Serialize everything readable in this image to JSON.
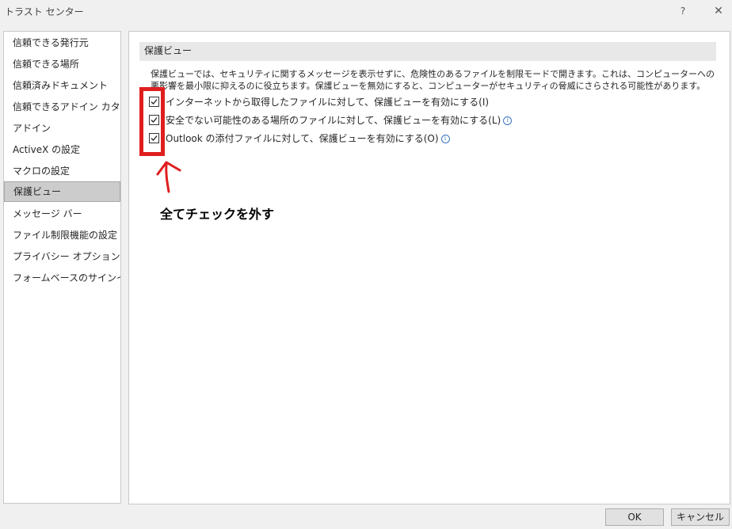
{
  "window": {
    "title": "トラスト センター",
    "help_label": "?",
    "close_label": "✕"
  },
  "sidebar": {
    "items": [
      {
        "label": "信頼できる発行元"
      },
      {
        "label": "信頼できる場所"
      },
      {
        "label": "信頼済みドキュメント"
      },
      {
        "label": "信頼できるアドイン カタログ"
      },
      {
        "label": "アドイン"
      },
      {
        "label": "ActiveX の設定"
      },
      {
        "label": "マクロの設定"
      },
      {
        "label": "保護ビュー",
        "selected": true
      },
      {
        "label": "メッセージ バー"
      },
      {
        "label": "ファイル制限機能の設定"
      },
      {
        "label": "プライバシー オプション"
      },
      {
        "label": "フォームベースのサインイン"
      }
    ]
  },
  "main": {
    "section_title": "保護ビュー",
    "description": "保護ビューでは、セキュリティに関するメッセージを表示せずに、危険性のあるファイルを制限モードで開きます。これは、コンピューターへの悪影響を最小限に抑えるのに役立ちます。保護ビューを無効にすると、コンピューターがセキュリティの脅威にさらされる可能性があります。",
    "options": [
      {
        "label": "インターネットから取得したファイルに対して、保護ビューを有効にする(I)",
        "checked": true,
        "info_icon": false
      },
      {
        "label": "安全でない可能性のある場所のファイルに対して、保護ビューを有効にする(L)",
        "checked": true,
        "info_icon": true
      },
      {
        "label": "Outlook の添付ファイルに対して、保護ビューを有効にする(O)",
        "checked": true,
        "info_icon": true
      }
    ]
  },
  "annotation": {
    "text": "全てチェックを外す",
    "color": "#e01e1e"
  },
  "footer": {
    "ok_label": "OK",
    "cancel_label": "キャンセル"
  },
  "icons": {
    "info": "info-icon",
    "check": "check-icon"
  }
}
